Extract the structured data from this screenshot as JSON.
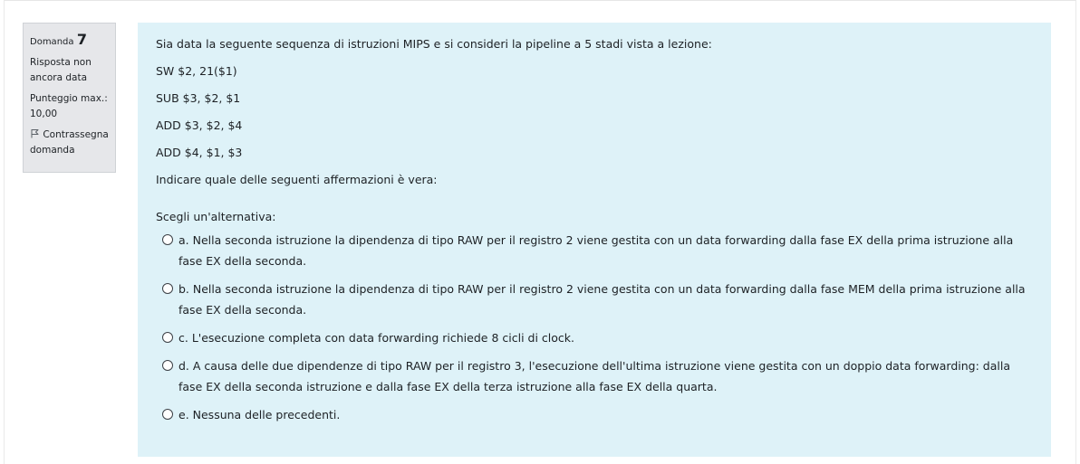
{
  "question_info": {
    "label": "Domanda",
    "number": "7",
    "state": "Risposta non ancora data",
    "grade": "Punteggio max.: 10,00",
    "flag_label": "Contrassegna domanda",
    "flag_icon": "flag-icon"
  },
  "question": {
    "intro": "Sia data la seguente sequenza di istruzioni MIPS e si consideri la pipeline a 5 stadi vista a lezione:",
    "instructions": [
      "SW $2, 21($1)",
      "SUB $3, $2, $1",
      "ADD $3, $2, $4",
      "ADD $4, $1, $3"
    ],
    "ask": "Indicare quale delle seguenti affermazioni è vera:"
  },
  "answer_block": {
    "prompt": "Scegli un'alternativa:",
    "options": [
      "a. Nella seconda istruzione la dipendenza di tipo RAW per il registro 2 viene gestita con un data forwarding dalla fase EX della prima istruzione alla fase EX della seconda.",
      "b. Nella seconda istruzione la dipendenza di tipo RAW per il registro 2 viene gestita con un data forwarding dalla fase MEM della prima istruzione alla fase EX della seconda.",
      "c. L'esecuzione completa con data forwarding richiede 8 cicli di clock.",
      "d. A causa delle due dipendenze di tipo RAW per il registro 3, l'esecuzione dell'ultima istruzione viene gestita con un doppio data forwarding: dalla fase EX della seconda istruzione e dalla fase EX della terza istruzione alla fase EX della quarta.",
      "e. Nessuna delle precedenti."
    ]
  },
  "colors": {
    "info_bg": "#e6e7ea",
    "content_bg": "#def2f8",
    "text": "#1d2125"
  }
}
